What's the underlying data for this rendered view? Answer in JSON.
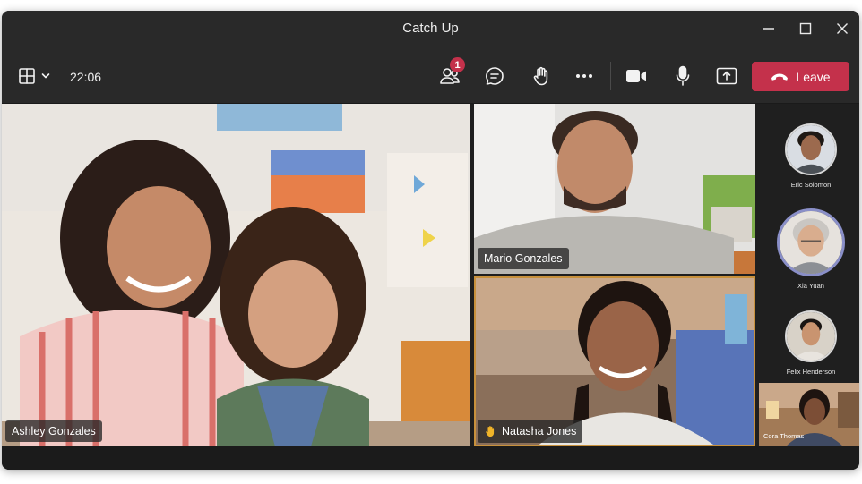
{
  "window": {
    "title": "Catch Up"
  },
  "window_controls": {
    "minimize_icon": "minimize-icon",
    "maximize_icon": "maximize-icon",
    "close_icon": "close-icon"
  },
  "toolbar": {
    "layout_icon": "grid-layout-icon",
    "timer": "22:06",
    "people_badge": "1",
    "leave_label": "Leave",
    "icons": [
      "people-icon",
      "chat-icon",
      "raise-hand-icon",
      "more-icon",
      "camera-icon",
      "microphone-icon",
      "share-screen-icon",
      "phone-hangup-icon"
    ]
  },
  "participants": {
    "main": {
      "name": "Ashley Gonzales"
    },
    "top_right": {
      "name": "Mario Gonzales"
    },
    "bottom_right": {
      "name": "Natasha Jones",
      "hand_raised": true
    },
    "sidebar": [
      {
        "name": "Eric Solomon"
      },
      {
        "name": "Xia Yuan",
        "speaking": true
      },
      {
        "name": "Felix Henderson"
      },
      {
        "name": "Cora Thomas"
      }
    ]
  },
  "colors": {
    "leave": "#c4314b",
    "badge": "#c4314b",
    "active_speaker_border": "#c8913c",
    "speaking_ring": "#8a8fc8",
    "titlebar": "#292929"
  }
}
